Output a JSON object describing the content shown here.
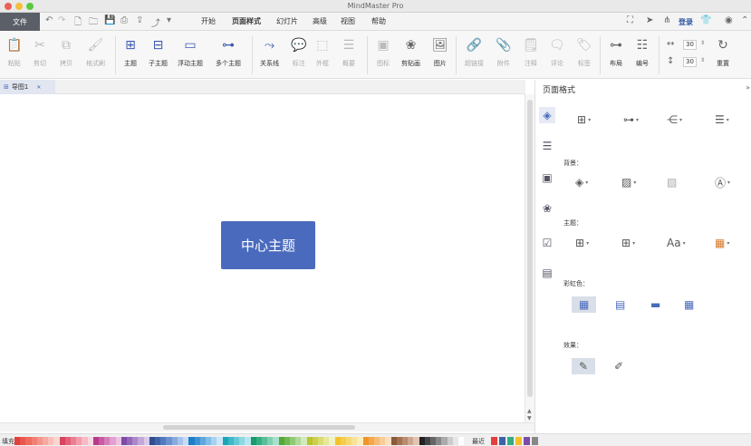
{
  "window": {
    "title": "MindMaster Pro"
  },
  "menubar": {
    "file": "文件",
    "items": [
      "开始",
      "页面样式",
      "幻灯片",
      "高级",
      "视图",
      "帮助"
    ],
    "login": "登录"
  },
  "ribbon": {
    "clipboard": [
      "粘贴",
      "剪切",
      "拷贝",
      "格式刷"
    ],
    "insert": [
      "主题",
      "子主题",
      "浮动主题",
      "多个主题"
    ],
    "relation": [
      "关系线",
      "标注",
      "外框",
      "概要"
    ],
    "media": [
      "图标",
      "剪贴画",
      "图片"
    ],
    "extras": [
      "超链接",
      "附件",
      "注释",
      "评论",
      "标签"
    ],
    "layout": [
      "布局",
      "编号"
    ],
    "spacing_value_1": "30",
    "spacing_value_2": "30",
    "reset": "重置"
  },
  "document": {
    "tab": "导图1"
  },
  "canvas": {
    "central_topic": "中心主题"
  },
  "panel": {
    "title": "页面格式",
    "background_label": "背景：",
    "theme_label": "主题：",
    "rainbow_label": "彩虹色：",
    "effect_label": "效果："
  },
  "palette": {
    "fill_label": "填充",
    "recent_label": "最近",
    "colors": [
      "#e23f3f",
      "#e8574c",
      "#f06b5e",
      "#f37f73",
      "#f5948a",
      "#f7aaa1",
      "#f9c0b9",
      "#fbd6d1",
      "#d8435f",
      "#e36079",
      "#ec7e93",
      "#f29cac",
      "#f7bac6",
      "#fbd8df",
      "#b73a8c",
      "#c95aa3",
      "#d77cba",
      "#e39fcf",
      "#eec2e2",
      "#7d4ca6",
      "#9467b8",
      "#ab86c9",
      "#c3a6da",
      "#dbc8ea",
      "#2f4e8f",
      "#3e63a8",
      "#5179bf",
      "#6a91d1",
      "#88aadf",
      "#a7c3eb",
      "#c7dbf5",
      "#1e7ec8",
      "#3b93d4",
      "#5ea8de",
      "#82bde7",
      "#a7d2f0",
      "#cbe6f7",
      "#1ba5b8",
      "#3db8c7",
      "#64c9d5",
      "#8dd9e2",
      "#b5e7ee",
      "#199a6f",
      "#34ad82",
      "#57bf99",
      "#7fd0b1",
      "#a8e0ca",
      "#58a639",
      "#72b955",
      "#90ca75",
      "#b0da98",
      "#d0eabd",
      "#bbc22c",
      "#cbd04c",
      "#d9dd72",
      "#e6e899",
      "#f1f2c1",
      "#f3c22b",
      "#f5cd4e",
      "#f7d873",
      "#f9e398",
      "#fbeebd",
      "#f0952a",
      "#f3a84d",
      "#f6bb72",
      "#f8cd97",
      "#fbdfbe",
      "#8a5a3b",
      "#a27254",
      "#b98c70",
      "#cfa78f",
      "#e2c4b2",
      "#222222",
      "#444444",
      "#666666",
      "#888888",
      "#aaaaaa",
      "#cccccc",
      "#e6e6e6",
      "#ffffff"
    ],
    "recent_colors": [
      "#e23f3f",
      "#3e63a8",
      "#34ad82",
      "#f3c22b",
      "#7d4ca6",
      "#888888"
    ]
  },
  "colors": {
    "accent": "#4a6bbd",
    "file_tab": "#5b5f68"
  }
}
